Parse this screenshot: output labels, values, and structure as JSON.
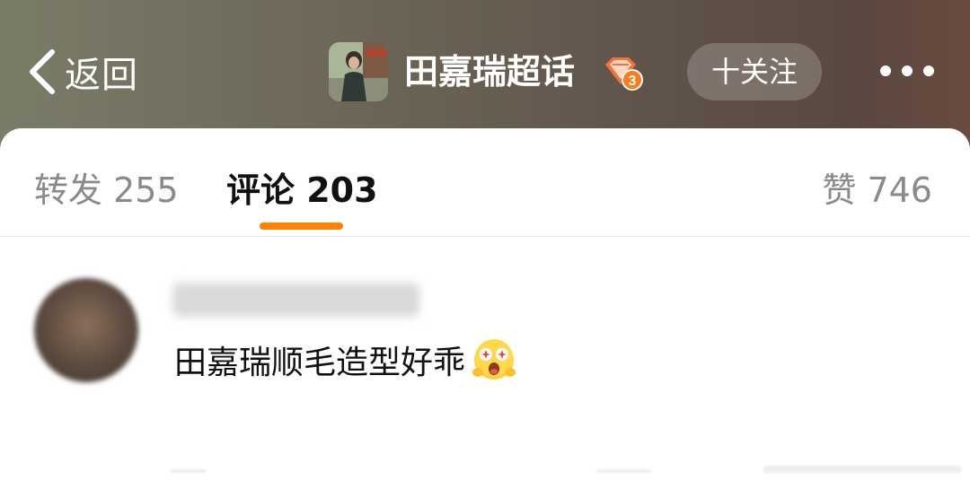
{
  "nav": {
    "back_label": "返回",
    "title": "田嘉瑞超话",
    "badge_level": "3",
    "follow_label": "十关注",
    "more_icon": "more-dots-icon"
  },
  "tabs": {
    "repost": "转发 255",
    "comment": "评论 203",
    "like": "赞 746"
  },
  "comment": {
    "text": "田嘉瑞顺毛造型好乖",
    "emoji": "starry-eyed-emoji"
  },
  "colors": {
    "accent": "#ff8200",
    "header_left": "#7a7c68",
    "header_right": "#6a4a3e"
  }
}
